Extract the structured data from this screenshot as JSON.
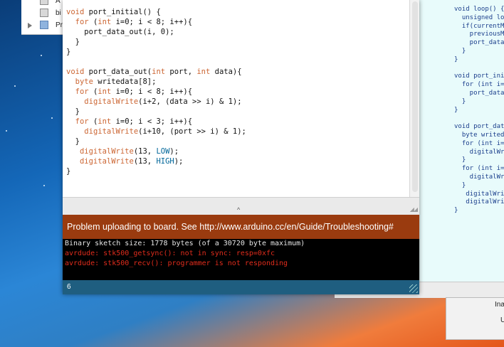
{
  "finder": {
    "items": [
      {
        "label": "A",
        "icon": "document-icon"
      },
      {
        "label": "bi",
        "icon": "document-icon"
      },
      {
        "label": "Pr",
        "icon": "folder-icon"
      }
    ]
  },
  "editor": {
    "lines": [
      "void port_initial() {",
      "  for (int i=0; i < 8; i++){",
      "    port_data_out(i, 0);",
      "  }",
      "}",
      "",
      "void port_data_out(int port, int data){",
      "  byte writedata[8];",
      "  for (int i=0; i < 8; i++){",
      "    digitalWrite(i+2, (data >> i) & 1);",
      "  }",
      "  for (int i=0; i < 3; i++){",
      "    digitalWrite(i+10, (port >> i) & 1);",
      "  }",
      "   digitalWrite(13, LOW);",
      "   digitalWrite(13, HIGH);",
      "}"
    ]
  },
  "status": {
    "message": "Problem uploading to board.  See http://www.arduino.cc/en/Guide/Troubleshooting#"
  },
  "console": {
    "lines": [
      {
        "text": "Binary sketch size: 1778 bytes (of a 30720 byte maximum)",
        "color": "#e6e6e6"
      },
      {
        "text": "avrdude: stk500_getsync(): not in sync: resp=0xfc",
        "color": "#e02c1c"
      },
      {
        "text": "avrdude: stk500_recv(): programmer is not responding",
        "color": "#e02c1c"
      }
    ]
  },
  "footer": {
    "line_number": "6"
  },
  "background_window": {
    "lines": [
      "void loop() {",
      "  unsigned lon",
      "  if(currentMi",
      "    previousMi",
      "    port_data_",
      "  }",
      "}",
      "",
      "void port_init",
      "  for (int i=0",
      "    port_data_",
      "  }",
      "}",
      "",
      "void port_data",
      "  byte writeda",
      "  for (int i=0",
      "    digitalWri",
      "  }",
      "  for (int i=0",
      "    digitalWri",
      "  }",
      "   digitalWrit",
      "   digitalWrit",
      "}"
    ]
  },
  "dialog": {
    "line1": "Ina",
    "line2": "U"
  },
  "colors": {
    "status_bg": "#9a3b0f",
    "console_bg": "#000000",
    "footer_bg": "#1f5e80",
    "keyword": "#cc6633",
    "constant": "#006699",
    "error_text": "#e02c1c"
  }
}
